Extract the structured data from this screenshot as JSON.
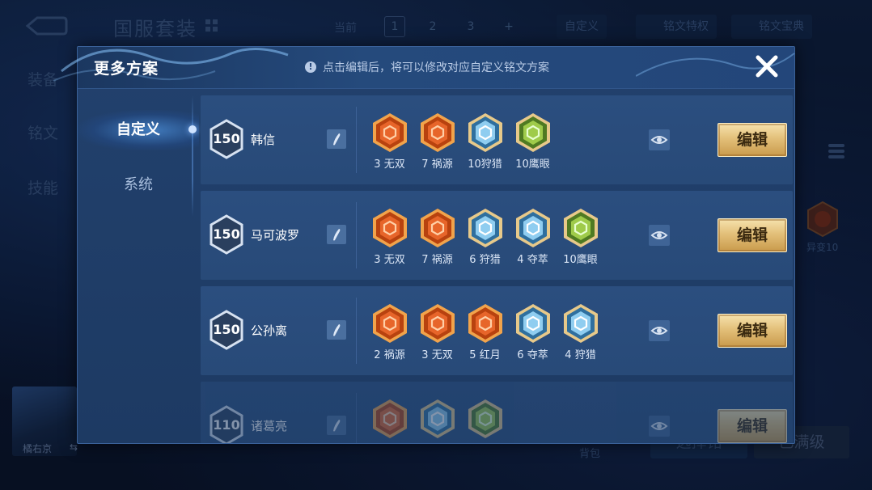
{
  "background": {
    "page_title": "国服套装",
    "current_label": "当前",
    "pages": [
      "1",
      "2",
      "3",
      "+"
    ],
    "custom_label": "自定义",
    "privilege_label": "铭文特权",
    "guide_label": "铭文宝典",
    "side_items": [
      "装备",
      "铭文",
      "技能"
    ],
    "rune_label": "异变10",
    "hero_name": "橘右京",
    "swap_icon": "⇆",
    "bag_label": "背包",
    "select_label": "选择铭",
    "max_label": "已满级"
  },
  "modal": {
    "title": "更多方案",
    "hint": "点击编辑后，将可以修改对应自定义铭文方案",
    "tabs": [
      {
        "label": "自定义",
        "active": true
      },
      {
        "label": "系统",
        "active": false
      }
    ],
    "edit_label": "编辑",
    "rows": [
      {
        "level": "150",
        "name": "韩信",
        "runes": [
          {
            "label": "3 无双",
            "color": "red",
            "icon": "wushuang-rune-icon"
          },
          {
            "label": "7 祸源",
            "color": "red",
            "icon": "huoyuan-rune-icon"
          },
          {
            "label": "10狩猎",
            "color": "blue",
            "icon": "shoulie-rune-icon"
          },
          {
            "label": "10鹰眼",
            "color": "green",
            "icon": "yingyan-rune-icon"
          }
        ]
      },
      {
        "level": "150",
        "name": "马可波罗",
        "runes": [
          {
            "label": "3 无双",
            "color": "red",
            "icon": "wushuang-rune-icon"
          },
          {
            "label": "7 祸源",
            "color": "red",
            "icon": "huoyuan-rune-icon"
          },
          {
            "label": "6 狩猎",
            "color": "blue",
            "icon": "shoulie-rune-icon"
          },
          {
            "label": "4 夺萃",
            "color": "blue",
            "icon": "duocui-rune-icon"
          },
          {
            "label": "10鹰眼",
            "color": "green",
            "icon": "yingyan-rune-icon"
          }
        ]
      },
      {
        "level": "150",
        "name": "公孙离",
        "runes": [
          {
            "label": "2 祸源",
            "color": "red",
            "icon": "huoyuan-rune-icon"
          },
          {
            "label": "3 无双",
            "color": "red",
            "icon": "wushuang-rune-icon"
          },
          {
            "label": "5 红月",
            "color": "red",
            "icon": "hongyue-rune-icon"
          },
          {
            "label": "6 夺萃",
            "color": "blue",
            "icon": "duocui-rune-icon"
          },
          {
            "label": "4 狩猎",
            "color": "blue",
            "icon": "shoulie-rune-icon"
          }
        ]
      },
      {
        "level": "110",
        "name": "诸葛亮",
        "runes": [
          {
            "label": "",
            "color": "red",
            "icon": "rune-icon"
          },
          {
            "label": "",
            "color": "blue",
            "icon": "rune-icon"
          },
          {
            "label": "",
            "color": "green",
            "icon": "rune-icon"
          }
        ]
      }
    ]
  },
  "colors": {
    "red_rune": "#d4541f",
    "blue_rune": "#5aa6d8",
    "green_rune": "#7fae3a",
    "gold_button": "#e3c07a"
  }
}
